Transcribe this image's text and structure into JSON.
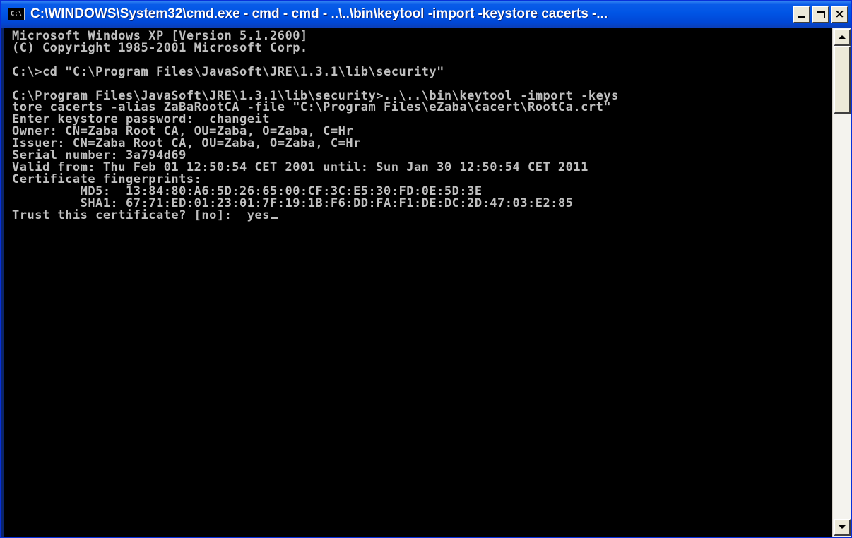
{
  "window": {
    "title": "C:\\WINDOWS\\System32\\cmd.exe - cmd - cmd - ..\\..\\bin\\keytool -import -keystore cacerts -...",
    "icon_label": "C:\\",
    "icon": "console-icon"
  },
  "title_buttons": {
    "minimize_icon": "minimize-icon",
    "maximize_icon": "maximize-icon",
    "close_icon": "close-icon",
    "close_glyph": "×"
  },
  "console": {
    "lines": [
      "Microsoft Windows XP [Version 5.1.2600]",
      "(C) Copyright 1985-2001 Microsoft Corp.",
      "",
      "C:\\>cd \"C:\\Program Files\\JavaSoft\\JRE\\1.3.1\\lib\\security\"",
      "",
      "C:\\Program Files\\JavaSoft\\JRE\\1.3.1\\lib\\security>..\\..\\bin\\keytool -import -keys",
      "tore cacerts -alias ZaBaRootCA -file \"C:\\Program Files\\eZaba\\cacert\\RootCa.crt\"",
      "Enter keystore password:  changeit",
      "Owner: CN=Zaba Root CA, OU=Zaba, O=Zaba, C=Hr",
      "Issuer: CN=Zaba Root CA, OU=Zaba, O=Zaba, C=Hr",
      "Serial number: 3a794d69",
      "Valid from: Thu Feb 01 12:50:54 CET 2001 until: Sun Jan 30 12:50:54 CET 2011",
      "Certificate fingerprints:",
      "         MD5:  13:84:80:A6:5D:26:65:00:CF:3C:E5:30:FD:0E:5D:3E",
      "         SHA1: 67:71:ED:01:23:01:7F:19:1B:F6:DD:FA:F1:DE:DC:2D:47:03:E2:85"
    ],
    "prompt": "Trust this certificate? [no]:  ",
    "input_value": "yes"
  },
  "scrollbar": {
    "up_icon": "scroll-up-arrow-icon",
    "down_icon": "scroll-down-arrow-icon"
  },
  "colors": {
    "console_bg": "#000000",
    "console_fg": "#c0c0c0",
    "titlebar": "#0055e5"
  }
}
